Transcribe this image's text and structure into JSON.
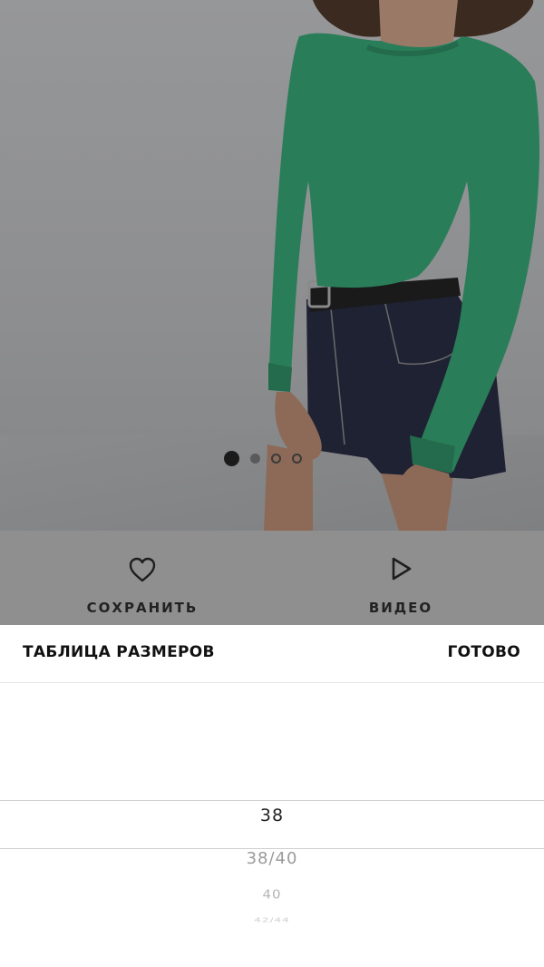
{
  "product": {
    "carousel": {
      "total": 4,
      "active_index": 0
    }
  },
  "actions": {
    "save_label": "СОХРАНИТЬ",
    "save_icon": "heart-icon",
    "video_label": "ВИДЕО",
    "video_icon": "play-icon"
  },
  "size_sheet": {
    "title": "ТАБЛИЦА РАЗМЕРОВ",
    "done_label": "ГОТОВО",
    "options": [
      "38",
      "38/40",
      "40",
      "42/44"
    ],
    "selected": "38"
  },
  "colors": {
    "sweater": "#2f8c63",
    "overlay": "#8f8f8f",
    "text": "#111111"
  }
}
